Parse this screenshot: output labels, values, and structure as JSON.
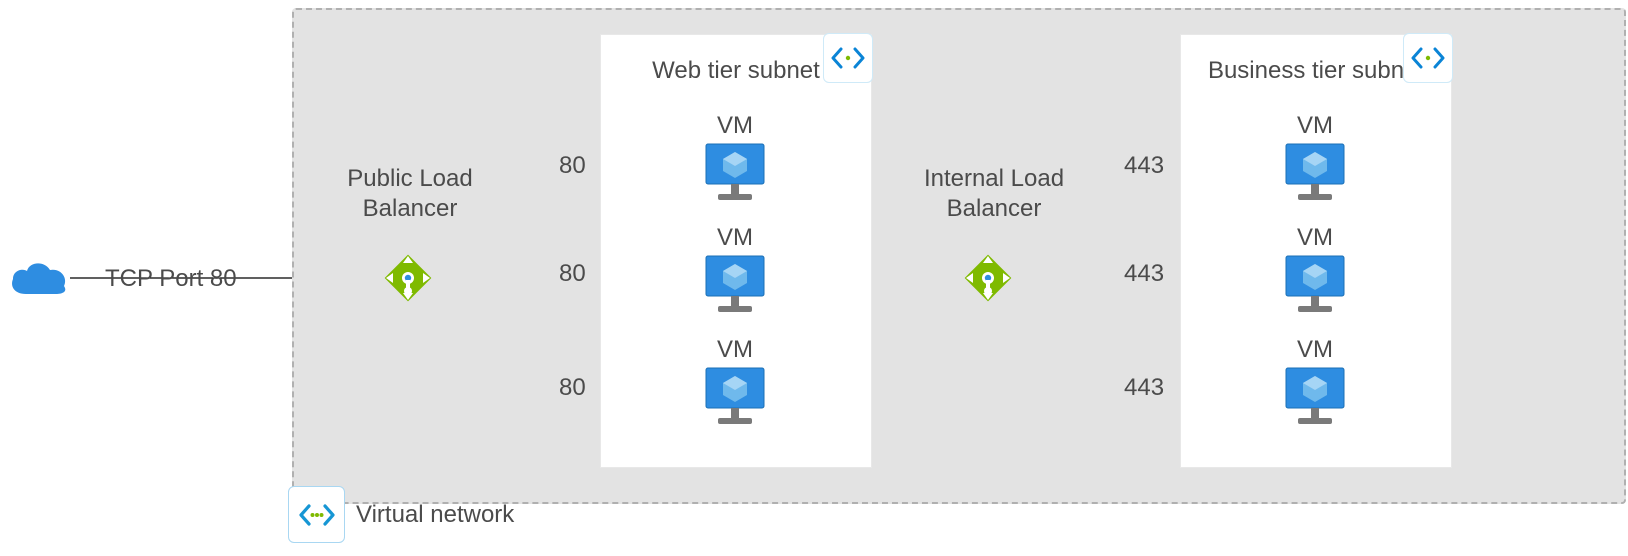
{
  "entry_label": "TCP Port 80",
  "vnet_label": "Virtual network",
  "public_lb_label": "Public Load\nBalancer",
  "internal_lb_label": "Internal Load\nBalancer",
  "subnets": {
    "web": {
      "title": "Web tier subnet",
      "vm_label": "VM",
      "port": "80"
    },
    "biz": {
      "title": "Business tier subnet",
      "vm_label": "VM",
      "port": "443"
    }
  }
}
